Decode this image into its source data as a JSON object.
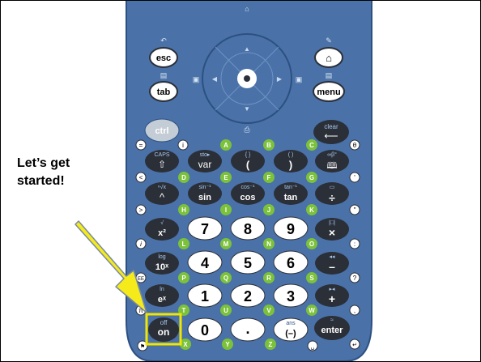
{
  "page": {
    "title_line1": "Let’s get",
    "title_line2": "started!"
  },
  "colors": {
    "body": "#4a72a8",
    "body_edge": "#2d5082",
    "dark_key": "#2b2f38",
    "light_key": "#ffffff",
    "green": "#7cc13a",
    "gray": "#c4ccd6",
    "arrow": "#f5eb1a",
    "highlight": "#f0e600",
    "label_blue": "#a9c8ec"
  },
  "nav": {
    "esc": "esc",
    "tab": "tab",
    "menu": "menu",
    "home_icon": "home-icon",
    "touchpad_icon": "touchpad-click-icon"
  },
  "keys": {
    "ctrl": "ctrl",
    "clear_top": "clear",
    "caps": "CAPS",
    "sto": "sto▸",
    "var": "var",
    "paren_open": "(",
    "paren_close": ")",
    "trig": [
      {
        "top": "sin⁻¹",
        "main": "sin"
      },
      {
        "top": "cos⁻¹",
        "main": "cos"
      },
      {
        "top": "tan⁻¹",
        "main": "tan"
      }
    ],
    "x2": "x²",
    "log_top": "log",
    "tenx": "10ˣ",
    "ln_top": "ln",
    "ex": "eˣ",
    "off": "off",
    "on": "on",
    "zero": "0",
    "dot": ".",
    "ans": "ans",
    "neg": "(–)",
    "enter": "enter",
    "digits_row1": [
      "7",
      "8",
      "9"
    ],
    "digits_row2": [
      "4",
      "5",
      "6"
    ],
    "digits_row3": [
      "1",
      "2",
      "3"
    ],
    "ops": [
      "×",
      "–",
      "+",
      "÷"
    ]
  },
  "letters": [
    "A",
    "B",
    "C",
    "D",
    "E",
    "F",
    "G",
    "H",
    "I",
    "J",
    "K",
    "L",
    "M",
    "N",
    "O",
    "P",
    "Q",
    "R",
    "S",
    "T",
    "U",
    "V",
    "W",
    "X",
    "Y",
    "Z"
  ]
}
